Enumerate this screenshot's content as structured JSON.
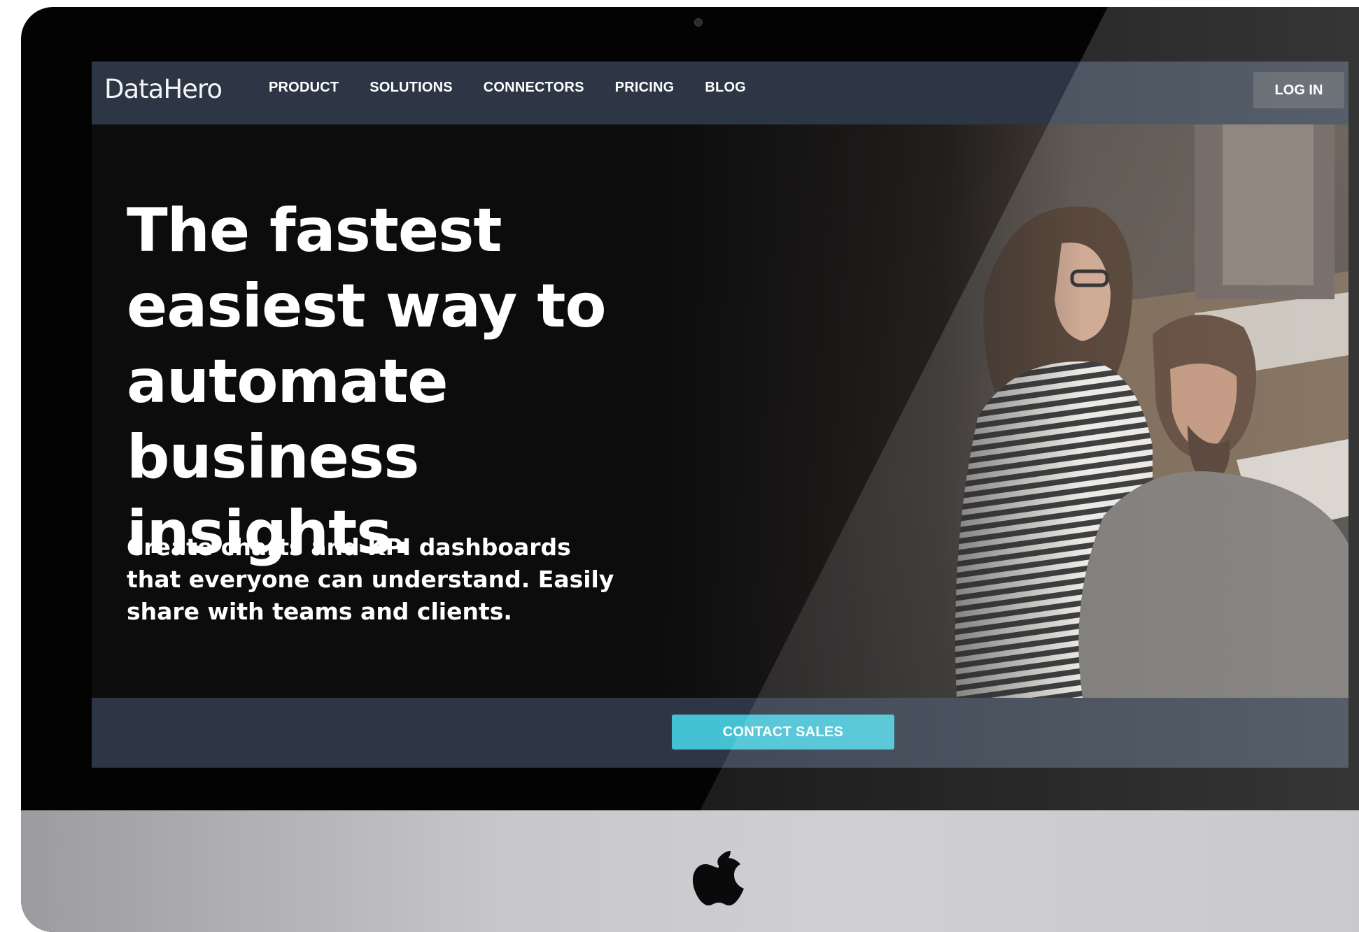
{
  "site": {
    "logo_text": "DataHero",
    "nav": [
      {
        "label": "PRODUCT"
      },
      {
        "label": "SOLUTIONS"
      },
      {
        "label": "CONNECTORS"
      },
      {
        "label": "PRICING"
      },
      {
        "label": "BLOG"
      }
    ],
    "login_label": "LOG IN"
  },
  "hero": {
    "headline_lines": [
      "The fastest",
      "easiest way to",
      "automate",
      "business",
      "insights."
    ],
    "subhead_lines": [
      "Create charts and KPI dashboards",
      "that everyone can understand. Easily",
      "share with teams and clients."
    ],
    "photo_icon": "team-meeting-photo"
  },
  "cta": {
    "label": "CONTACT SALES"
  },
  "device": {
    "logo_icon": "apple-logo-icon",
    "camera_icon": "camera-icon"
  },
  "colors": {
    "navbar": "#2c3644",
    "hero_bg": "#0c0c0d",
    "cta": "#44c1d3",
    "login_bg": "#4a5159",
    "bezel": "#030303",
    "chin": "#c7c7cb"
  }
}
